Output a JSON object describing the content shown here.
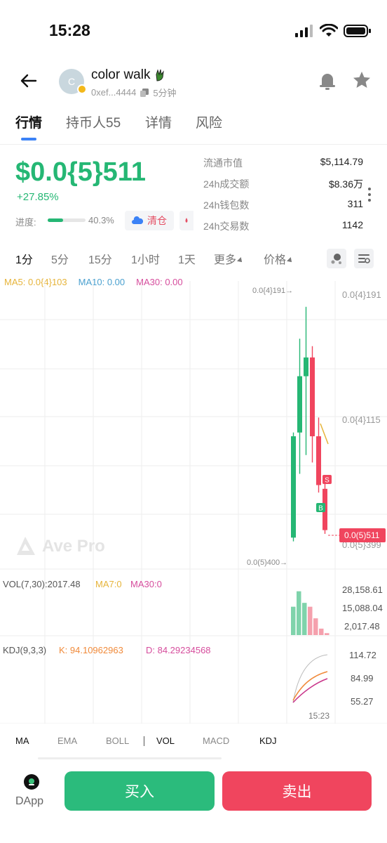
{
  "status_bar": {
    "time": "15:28"
  },
  "header": {
    "token_name": "color walk",
    "avatar_letter": "C",
    "address": "0xef...4444",
    "age": "5分钟"
  },
  "tabs": [
    {
      "label": "行情",
      "active": true
    },
    {
      "label": "持币人55",
      "active": false
    },
    {
      "label": "详情",
      "active": false
    },
    {
      "label": "风险",
      "active": false
    }
  ],
  "summary": {
    "price": "$0.0{5}511",
    "change": "+27.85%",
    "progress_label": "进度:",
    "progress_pct": "40.3%",
    "progress_value": 0.403,
    "clear_label": "清仓"
  },
  "stats": [
    {
      "label": "流通市值",
      "value": "$5,114.79"
    },
    {
      "label": "24h成交额",
      "value": "$8.36万"
    },
    {
      "label": "24h钱包数",
      "value": "311"
    },
    {
      "label": "24h交易数",
      "value": "1142"
    }
  ],
  "intervals": [
    {
      "label": "1分",
      "active": true
    },
    {
      "label": "5分",
      "active": false
    },
    {
      "label": "15分",
      "active": false
    },
    {
      "label": "1小时",
      "active": false
    },
    {
      "label": "1天",
      "active": false
    },
    {
      "label": "更多",
      "active": false
    },
    {
      "label": "价格",
      "active": false
    }
  ],
  "ma_legend": {
    "ma5": "MA5: 0.0{4}103",
    "ma10": "MA10: 0.00",
    "ma30": "MA30: 0.00"
  },
  "chart_data": {
    "type": "candlestick",
    "price_axis_labels": [
      "0.0{4}191",
      "0.0{4}115",
      "0.0{5}399"
    ],
    "current_price_label": "0.0(5)511",
    "high_marker": "0.0{4}191→",
    "low_marker": "0.0(5)400→",
    "trade_markers": [
      "S",
      "B"
    ],
    "watermark": "Ave Pro",
    "candles": [
      {
        "open": 5.0,
        "close": 32.0,
        "high": 33.0,
        "low": 4.0,
        "dir": "up"
      },
      {
        "open": 33.0,
        "close": 48.0,
        "high": 58.0,
        "low": 22.0,
        "dir": "up"
      },
      {
        "open": 48.0,
        "close": 53.0,
        "high": 66.5,
        "low": 27.0,
        "dir": "up"
      },
      {
        "open": 53.0,
        "close": 32.0,
        "high": 56.0,
        "low": 25.0,
        "dir": "down"
      },
      {
        "open": 32.0,
        "close": 19.0,
        "high": 37.0,
        "low": 17.0,
        "dir": "down"
      },
      {
        "open": 18.0,
        "close": 7.0,
        "high": 20.0,
        "low": 6.0,
        "dir": "down"
      }
    ],
    "volume": {
      "legend": "VOL(7,30):2017.48",
      "ma7": "MA7:0",
      "ma30": "MA30:0",
      "axis_labels": [
        "28,158.61",
        "15,088.04",
        "2,017.48"
      ],
      "bars": [
        {
          "value": 22000,
          "dir": "up"
        },
        {
          "value": 34000,
          "dir": "up"
        },
        {
          "value": 25000,
          "dir": "up"
        },
        {
          "value": 22000,
          "dir": "down"
        },
        {
          "value": 13000,
          "dir": "down"
        },
        {
          "value": 5000,
          "dir": "down"
        },
        {
          "value": 1500,
          "dir": "down"
        }
      ]
    },
    "kdj": {
      "legend": "KDJ(9,3,3)",
      "k_label": "K: 94.10962963",
      "d_label": "D: 84.29234568",
      "axis_labels": [
        "114.72",
        "84.99",
        "55.27"
      ],
      "time_label": "15:23"
    }
  },
  "indicators": [
    {
      "label": "MA",
      "active": true
    },
    {
      "label": "EMA",
      "active": false
    },
    {
      "label": "BOLL",
      "active": false
    },
    {
      "label": "VOL",
      "active": true
    },
    {
      "label": "MACD",
      "active": false
    },
    {
      "label": "KDJ",
      "active": true
    }
  ],
  "footer": {
    "dapp_label": "DApp",
    "buy_label": "买入",
    "sell_label": "卖出"
  },
  "colors": {
    "up": "#25b774",
    "down": "#f0455e",
    "accent": "#3b82f6"
  }
}
